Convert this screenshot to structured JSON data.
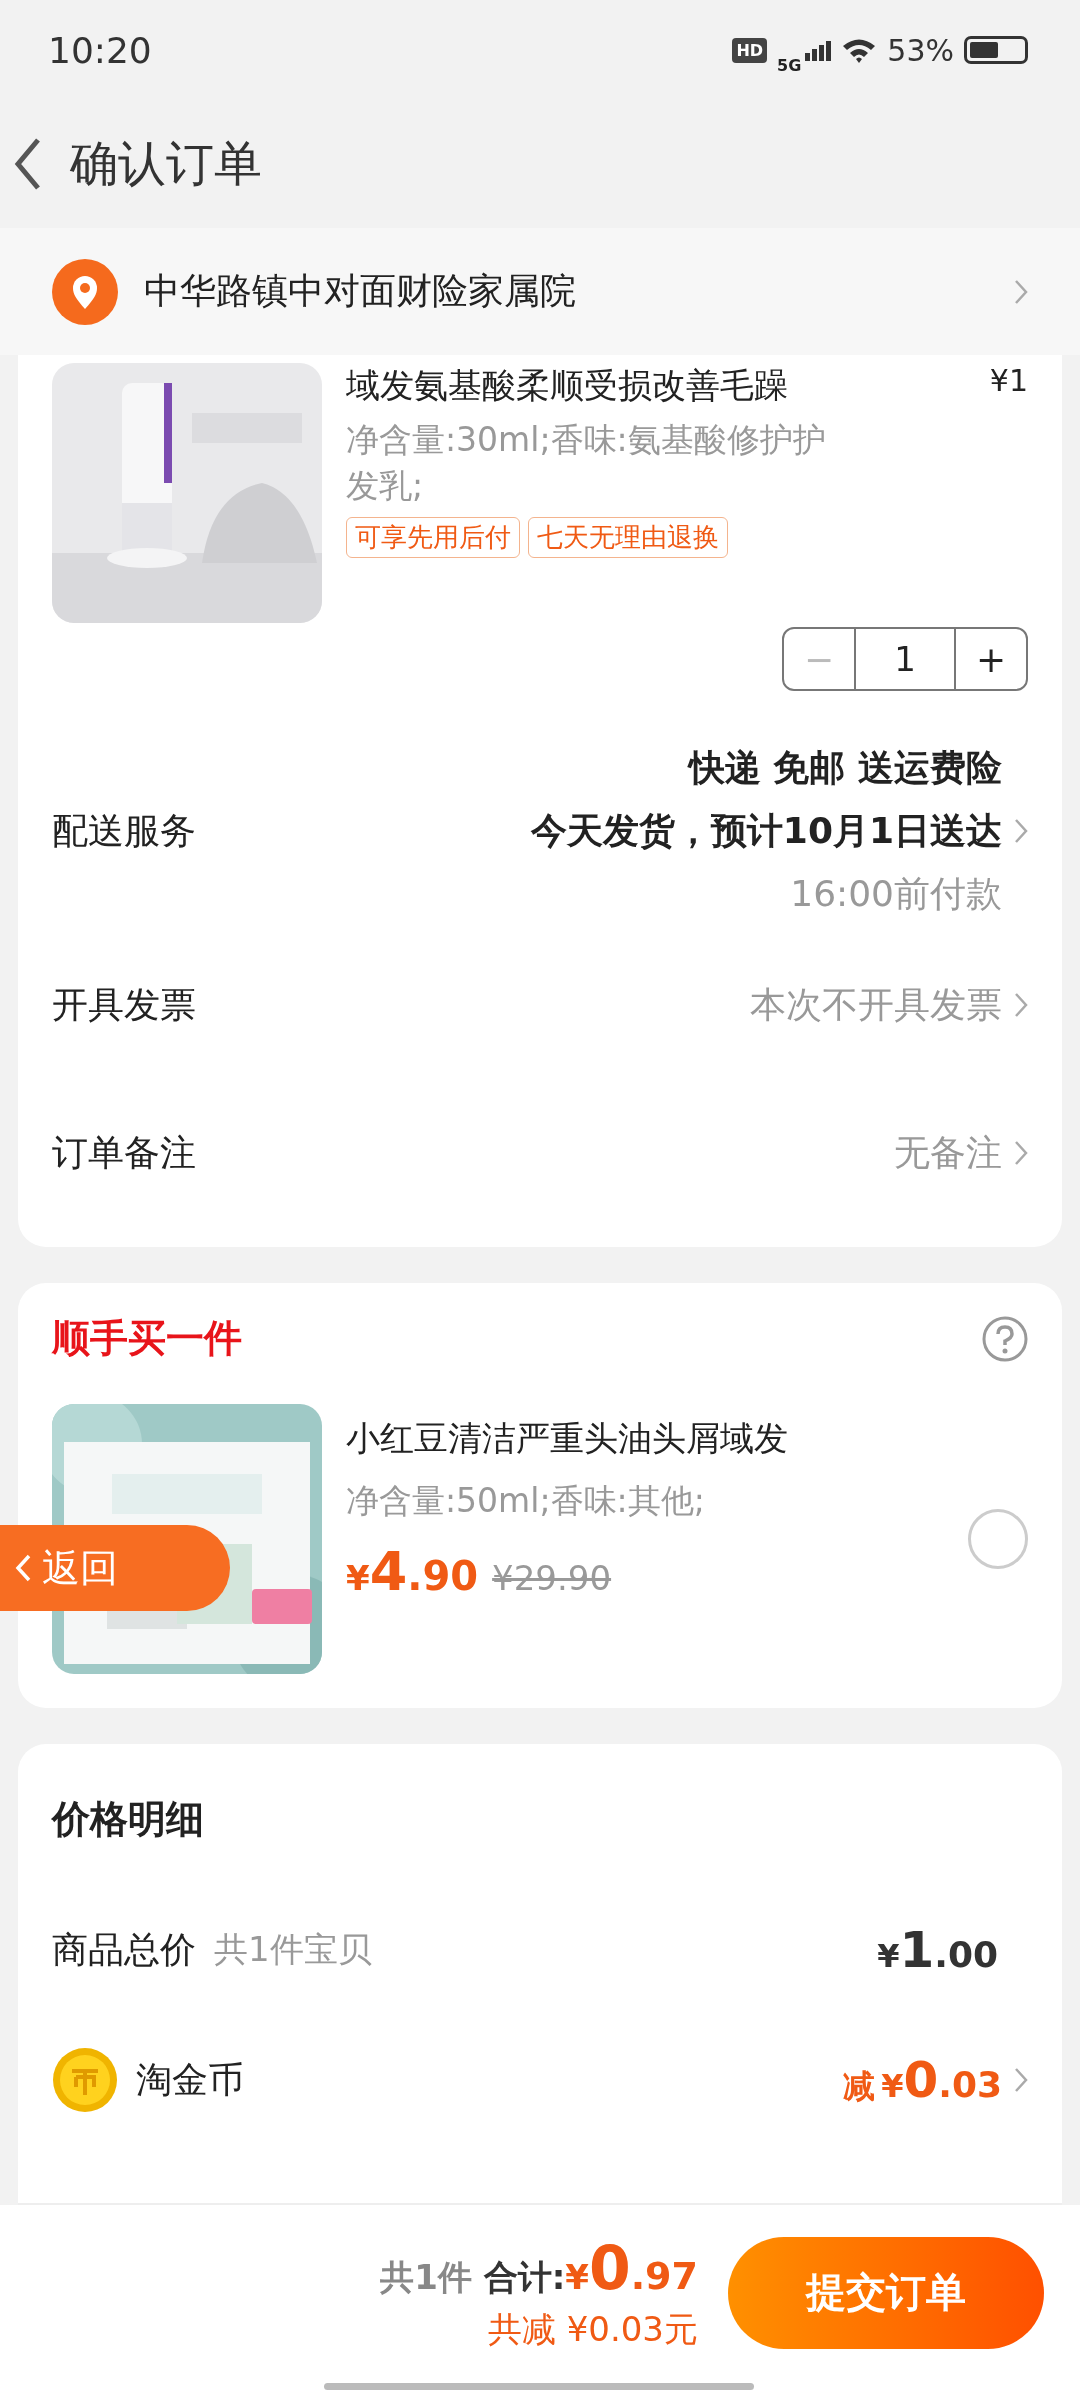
{
  "status_bar": {
    "time": "10:20",
    "hd": "HD",
    "network": "5G",
    "battery": "53%"
  },
  "header": {
    "title": "确认订单"
  },
  "address": {
    "text": "中华路镇中对面财险家属院"
  },
  "order_item": {
    "kind": "picture",
    "title": "域发氨基酸柔顺受损改善毛躁",
    "price": "¥1",
    "spec": "净含量:30ml;香味:氨基酸修护护发乳;",
    "tags": [
      "可享先用后付",
      "七天无理由退换"
    ],
    "decrement": "−",
    "quantity": "1",
    "increment": "+"
  },
  "rows": [
    {
      "kind": "delivery",
      "label": "配送服务",
      "lines": [
        "快递 免邮 送运费险",
        "今天发货，预计10月1日送达"
      ],
      "note": "16:00前付款"
    },
    {
      "kind": "plain",
      "label": "开具发票",
      "value": "本次不开具发票"
    },
    {
      "kind": "plain",
      "label": "订单备注",
      "value": "无备注"
    }
  ],
  "add_on": {
    "title": "顺手买一件",
    "product": {
      "kind": "picture",
      "title": "小红豆清洁严重头油头屑域发",
      "spec": "净含量:50ml;香味:其他;",
      "symbol": "¥",
      "int": "4",
      "dec": ".90",
      "original_price": "¥29.90",
      "selected": false
    }
  },
  "back_button": {
    "label": "返回"
  },
  "price_detail": {
    "title": "价格明细",
    "rows": [
      {
        "kind": "total",
        "label": "商品总价",
        "note": "共1件宝贝",
        "symbol": "¥",
        "int": "1",
        "dec": ".00"
      },
      {
        "kind": "coin",
        "label": "淘金币",
        "prefix": "减",
        "symbol": "¥",
        "int": "0",
        "dec": ".03"
      }
    ]
  },
  "footer": {
    "count": "共1件",
    "total_label": "合计:",
    "symbol": "¥",
    "int": "0",
    "dec": ".97",
    "saving": "共减 ¥0.03元",
    "submit": "提交订单"
  }
}
